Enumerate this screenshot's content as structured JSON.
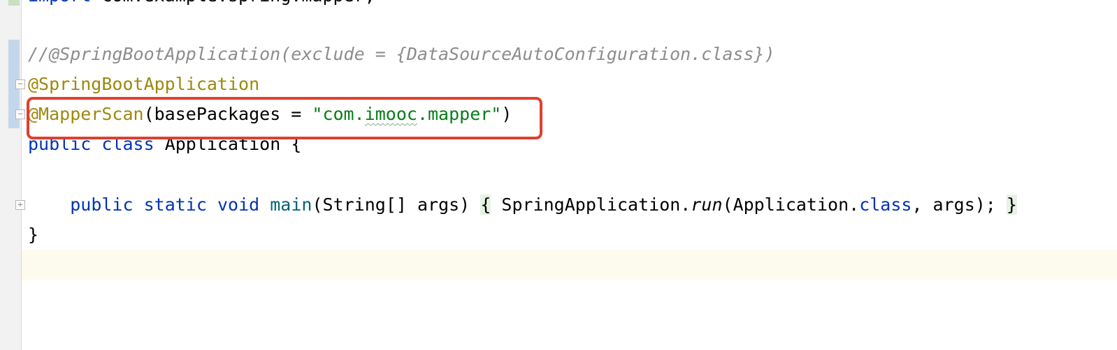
{
  "editor": {
    "accent_colors": {
      "keyword": "#0033b3",
      "annotation": "#9e880d",
      "string": "#067d17",
      "comment": "#8c8c8c",
      "method": "#00627a",
      "highlight_box": "#e0402f"
    },
    "lines": {
      "partial_import": {
        "keyword": "import",
        "rest": " com.example.spring.mapper;"
      },
      "comment": "//@SpringBootApplication(exclude = {DataSourceAutoConfiguration.class})",
      "annotation1": "@SpringBootApplication",
      "annotation2": {
        "name": "@MapperScan",
        "param_open": "(basePackages = ",
        "str_q1": "\"com.",
        "str_typo": "imooc",
        "str_rest": ".mapper\"",
        "close": ")"
      },
      "class_decl": {
        "kw1": "public",
        "kw2": "class",
        "name": "Application",
        "brace": "{"
      },
      "main_method": {
        "kw1": "public",
        "kw2": "static",
        "kw3": "void",
        "name": "main",
        "params": "(String[] args)",
        "open_brace": "{",
        "body_a": " SpringApplication.",
        "run": "run",
        "body_b": "(Application.",
        "class_kw": "class",
        "body_c": ", args); ",
        "close_brace": "}"
      },
      "class_close": "}"
    }
  }
}
